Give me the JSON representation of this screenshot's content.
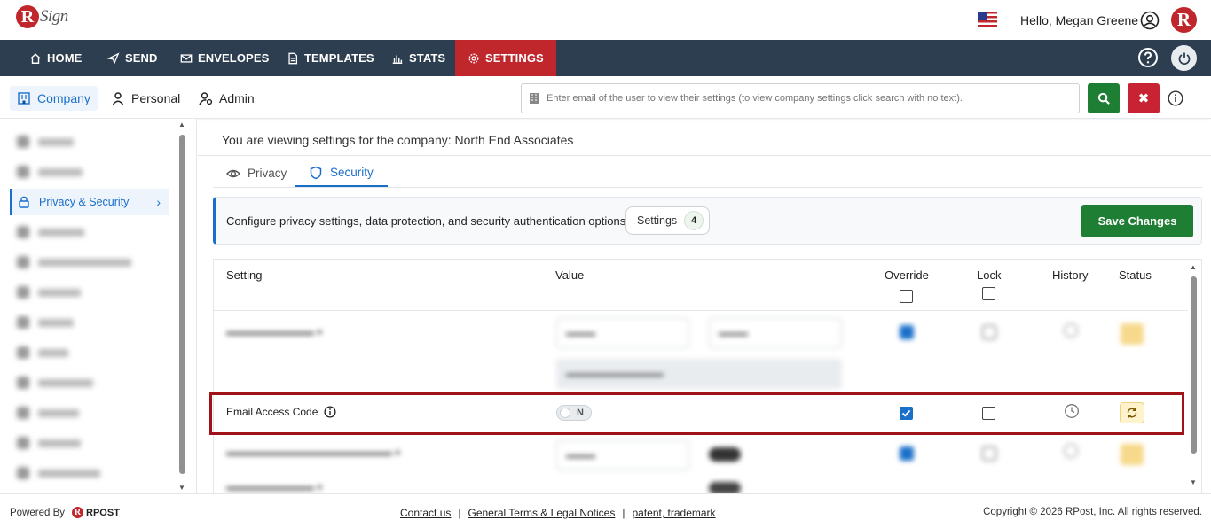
{
  "header": {
    "logo_text": "Sign",
    "greeting": "Hello, Megan Greene",
    "brand_letter": "R"
  },
  "nav": {
    "items": [
      {
        "label": "HOME",
        "icon": "home-icon"
      },
      {
        "label": "SEND",
        "icon": "send-icon"
      },
      {
        "label": "ENVELOPES",
        "icon": "envelope-icon"
      },
      {
        "label": "TEMPLATES",
        "icon": "document-icon"
      },
      {
        "label": "STATS",
        "icon": "bar-chart-icon"
      },
      {
        "label": "SETTINGS",
        "icon": "gear-icon",
        "active": true
      }
    ],
    "active_color": "#c0272d",
    "bar_color": "#2d3e50"
  },
  "subnav": {
    "tabs": [
      {
        "label": "Company",
        "icon": "building-icon",
        "active": true
      },
      {
        "label": "Personal",
        "icon": "person-icon"
      },
      {
        "label": "Admin",
        "icon": "person-gear-icon"
      }
    ],
    "search_placeholder": "Enter email of the user to view their settings (to view company settings click search with no text)."
  },
  "sidebar": {
    "active_item": "Privacy & Security"
  },
  "main": {
    "title": "You are viewing settings for the company: North End Associates",
    "tabs": [
      {
        "label": "Privacy",
        "icon": "eye-icon"
      },
      {
        "label": "Security",
        "icon": "shield-icon",
        "active": true
      }
    ],
    "info_text": "Configure privacy settings, data protection, and security authentication options.",
    "settings_label": "Settings",
    "settings_count": "4",
    "save_label": "Save Changes"
  },
  "table": {
    "headers": {
      "setting": "Setting",
      "value": "Value",
      "override": "Override",
      "lock": "Lock",
      "history": "History",
      "status": "Status"
    },
    "rows": [
      {
        "setting": "Email Access Code",
        "value": "N",
        "override": true,
        "lock": false
      }
    ]
  },
  "footer": {
    "powered_by": "Powered By",
    "rpost": "RPOST",
    "links": [
      "Contact us",
      "General Terms & Legal Notices",
      "patent, trademark"
    ],
    "copyright": "Copyright © 2026 RPost, Inc. All rights reserved."
  }
}
